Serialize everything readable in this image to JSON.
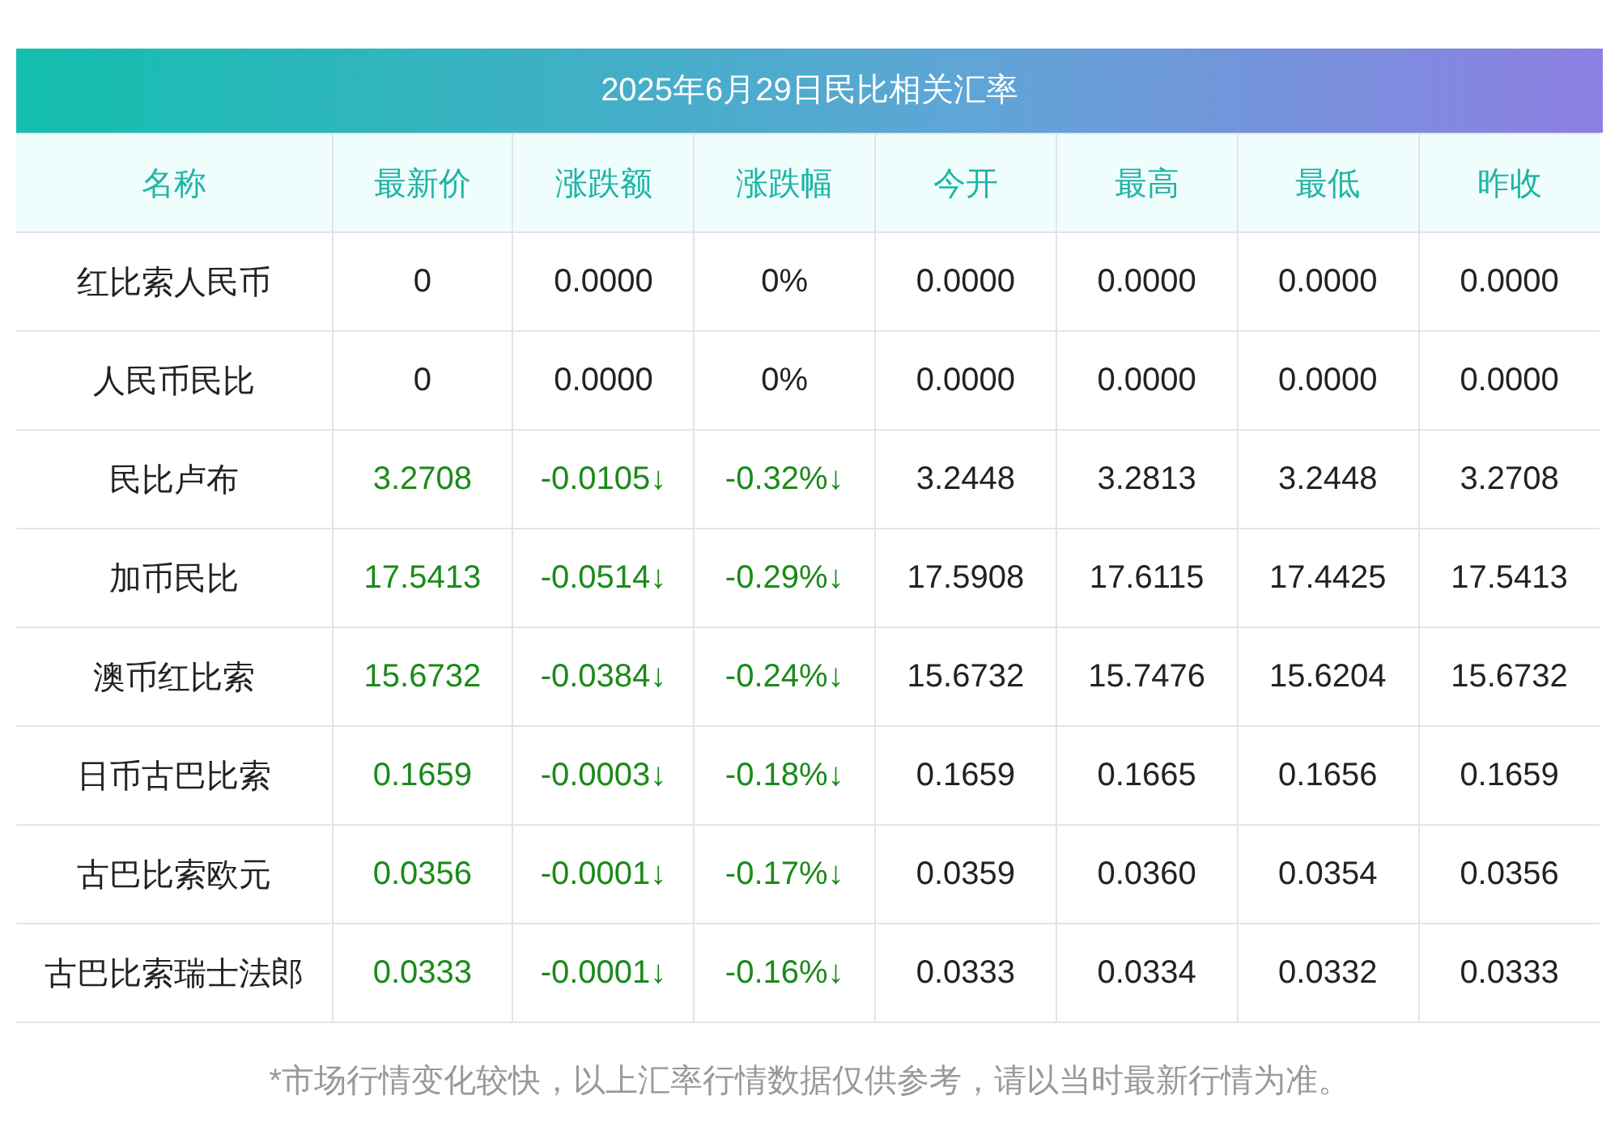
{
  "title": "2025年6月29日民比相关汇率",
  "columns": [
    "名称",
    "最新价",
    "涨跌额",
    "涨跌幅",
    "今开",
    "最高",
    "最低",
    "昨收"
  ],
  "rows": [
    {
      "kind": "flat",
      "cells": [
        "红比索人民币",
        "0",
        "0.0000",
        "0%",
        "0.0000",
        "0.0000",
        "0.0000",
        "0.0000"
      ]
    },
    {
      "kind": "flat",
      "cells": [
        "人民币民比",
        "0",
        "0.0000",
        "0%",
        "0.0000",
        "0.0000",
        "0.0000",
        "0.0000"
      ]
    },
    {
      "kind": "down",
      "cells": [
        "民比卢布",
        "3.2708",
        "-0.0105↓",
        "-0.32%↓",
        "3.2448",
        "3.2813",
        "3.2448",
        "3.2708"
      ]
    },
    {
      "kind": "down",
      "cells": [
        "加币民比",
        "17.5413",
        "-0.0514↓",
        "-0.29%↓",
        "17.5908",
        "17.6115",
        "17.4425",
        "17.5413"
      ]
    },
    {
      "kind": "down",
      "cells": [
        "澳币红比索",
        "15.6732",
        "-0.0384↓",
        "-0.24%↓",
        "15.6732",
        "15.7476",
        "15.6204",
        "15.6732"
      ]
    },
    {
      "kind": "down",
      "cells": [
        "日币古巴比索",
        "0.1659",
        "-0.0003↓",
        "-0.18%↓",
        "0.1659",
        "0.1665",
        "0.1656",
        "0.1659"
      ]
    },
    {
      "kind": "down",
      "cells": [
        "古巴比索欧元",
        "0.0356",
        "-0.0001↓",
        "-0.17%↓",
        "0.0359",
        "0.0360",
        "0.0354",
        "0.0356"
      ]
    },
    {
      "kind": "down",
      "cells": [
        "古巴比索瑞士法郎",
        "0.0333",
        "-0.0001↓",
        "-0.16%↓",
        "0.0333",
        "0.0334",
        "0.0332",
        "0.0333"
      ]
    }
  ],
  "note": "*市场行情变化较快，以上汇率行情数据仅供参考，请以当时最新行情为准。"
}
